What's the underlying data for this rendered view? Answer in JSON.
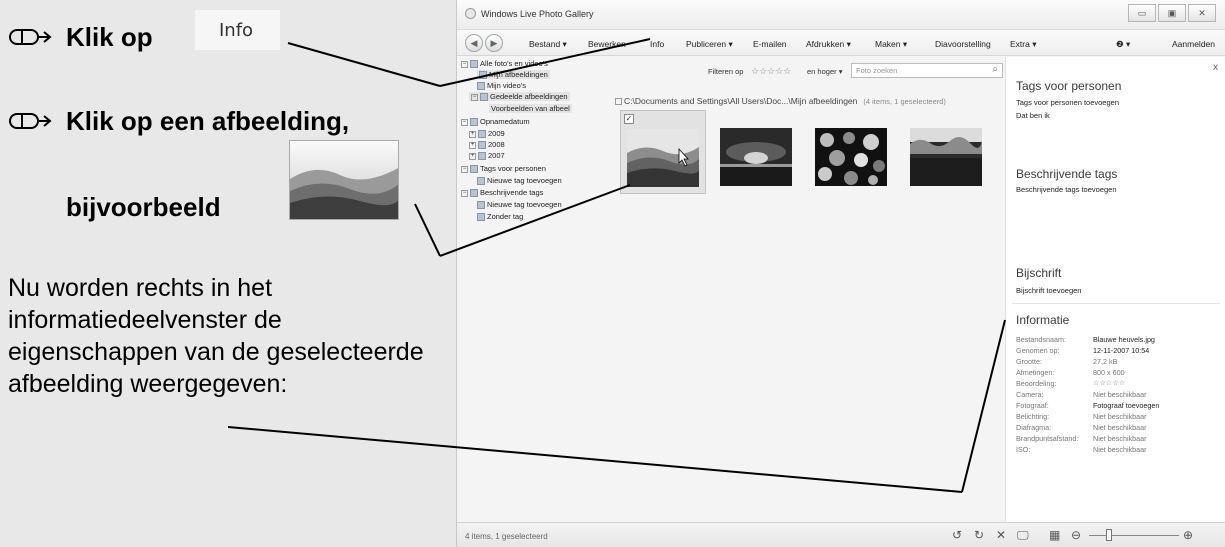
{
  "instructions": {
    "step1_label": "Klik op",
    "step1_chip": "Info",
    "step2_label": "Klik op een afbeelding,",
    "step2_example": "bijvoorbeeld",
    "description": "Nu worden rechts in het informatiedeelvenster de eigenschappen van de geselecteerde afbeelding weergegeven:"
  },
  "window": {
    "title": "Windows Live Photo Gallery",
    "controls": [
      "▭",
      "▣",
      "✕"
    ]
  },
  "menu": {
    "items": [
      "Bestand ▾",
      "Bewerken",
      "Info",
      "Publiceren ▾",
      "E-mailen",
      "Afdrukken ▾",
      "Maken ▾",
      "Diavoorstelling",
      "Extra ▾"
    ],
    "help": "❷ ▾",
    "signin": "Aanmelden"
  },
  "tree": {
    "nodes": [
      "Alle foto's en video's",
      "Mijn afbeeldingen",
      "Mijn video's",
      "Gedeelde afbeeldingen",
      "Voorbeelden van afbeel",
      "Opnamedatum",
      "2009",
      "2008",
      "2007",
      "Tags voor personen",
      "Nieuwe tag toevoegen",
      "Beschrijvende tags",
      "Nieuwe tag toevoegen",
      "Zonder tag"
    ]
  },
  "filter": {
    "label": "Filteren op",
    "stars": "☆☆☆☆☆",
    "suffix": "en hoger ▾",
    "search_placeholder": "Foto zoeken",
    "search_icon": "⌕"
  },
  "gallery": {
    "path": "C:\\Documents and Settings\\All Users\\Doc...\\Mijn afbeeldingen",
    "count": "(4 items, 1 geselecteerd)",
    "check": "✓"
  },
  "pane": {
    "close": "x",
    "people_heading": "Tags voor personen",
    "people_add": "Tags voor personen toevoegen",
    "people_me": "Dat ben ik",
    "desc_heading": "Beschrijvende tags",
    "desc_add": "Beschrijvende tags toevoegen",
    "caption_heading": "Bijschrift",
    "caption_add": "Bijschrift toevoegen",
    "info_heading": "Informatie",
    "properties": [
      {
        "k": "Bestandsnaam:",
        "v": "Blauwe heuvels.jpg"
      },
      {
        "k": "Genomen op:",
        "v": "12-11-2007 10:54"
      },
      {
        "k": "Grootte:",
        "v": "27,2 kB"
      },
      {
        "k": "Afmetingen:",
        "v": "800 x 600"
      },
      {
        "k": "Beoordeling:",
        "v": "☆☆☆☆☆"
      },
      {
        "k": "Camera:",
        "v": "Niet beschikbaar"
      },
      {
        "k": "Fotograaf:",
        "v": "Fotograaf toevoegen"
      },
      {
        "k": "Belichting:",
        "v": "Niet beschikbaar"
      },
      {
        "k": "Diafragma:",
        "v": "Niet beschikbaar"
      },
      {
        "k": "Brandpuntsafstand:",
        "v": "Niet beschikbaar"
      },
      {
        "k": "ISO:",
        "v": "Niet beschikbaar"
      }
    ]
  },
  "status": {
    "text": "4 items, 1 geselecteerd",
    "icons": [
      "↺",
      "↻",
      "✕",
      "🖵",
      "▦",
      "⊖",
      "⊕"
    ]
  },
  "colors": {
    "left_panel": "#e8e8e8",
    "window_bg": "#f4f4f4",
    "selection": "#e2e2e2"
  }
}
